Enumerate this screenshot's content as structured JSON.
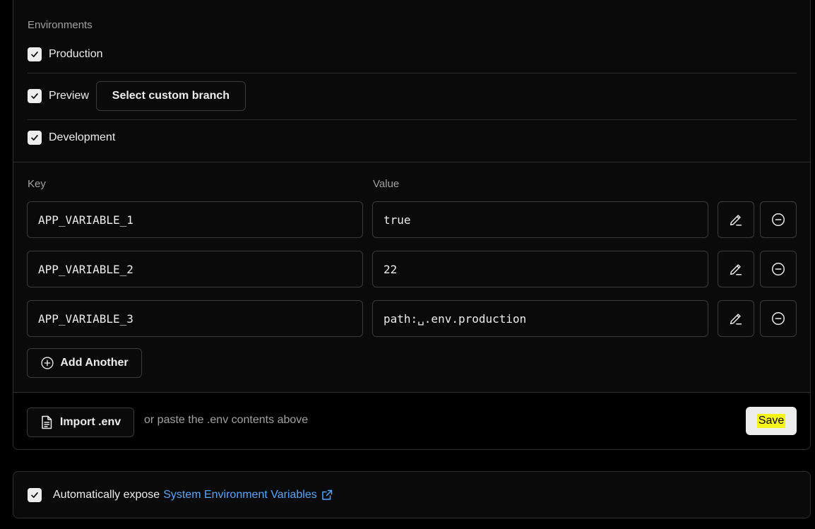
{
  "environments": {
    "title": "Environments",
    "items": [
      {
        "label": "Production",
        "checked": true
      },
      {
        "label": "Preview",
        "checked": true
      },
      {
        "label": "Development",
        "checked": true
      }
    ],
    "custom_branch_label": "Select custom branch"
  },
  "variables": {
    "key_label": "Key",
    "value_label": "Value",
    "rows": [
      {
        "key": "APP_VARIABLE_1",
        "value": "true"
      },
      {
        "key": "APP_VARIABLE_2",
        "value": "22"
      },
      {
        "key": "APP_VARIABLE_3",
        "value": "path:␣.env.production"
      }
    ],
    "add_another_label": "Add Another"
  },
  "actions": {
    "import_label": "Import .env",
    "paste_hint": "or paste the .env contents above",
    "save_label": "Save"
  },
  "footer": {
    "text": "Automatically expose",
    "link": "System Environment Variables"
  },
  "colors": {
    "background": "#000000",
    "card": "#0a0a0a",
    "border": "#2e2e2e",
    "link": "#52a8ff",
    "highlight": "#f6f51a"
  },
  "icons": {
    "checkbox": "check-icon",
    "edit": "pencil-icon",
    "remove": "minus-circle-icon",
    "add": "plus-circle-icon",
    "import": "file-icon",
    "external": "external-link-icon"
  }
}
